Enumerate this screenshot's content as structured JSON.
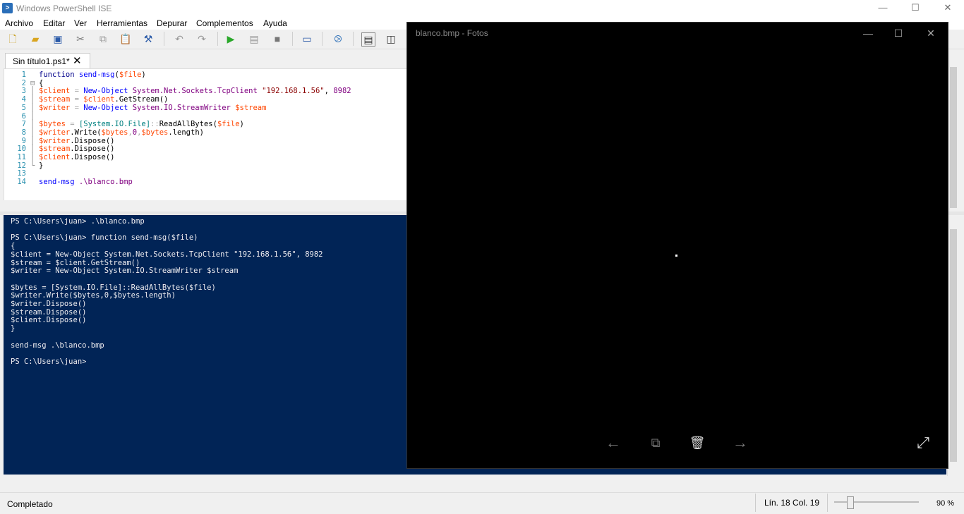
{
  "app": {
    "title": "Windows PowerShell ISE",
    "icon_glyph": ">",
    "minimize": "—",
    "maximize": "☐",
    "close": "✕"
  },
  "menu": [
    "Archivo",
    "Editar",
    "Ver",
    "Herramientas",
    "Depurar",
    "Complementos",
    "Ayuda"
  ],
  "toolbar": {
    "icons": [
      "new-file-icon",
      "open-folder-icon",
      "save-icon",
      "cut-icon",
      "copy-icon",
      "paste-icon",
      "clear-icon",
      "undo-icon",
      "redo-icon",
      "run-icon",
      "run-selection-icon",
      "stop-icon",
      "remote-icon",
      "powershell-icon",
      "layout-top-icon",
      "layout-side-icon"
    ]
  },
  "tab": {
    "label": "Sin título1.ps1*",
    "close": "✕"
  },
  "editor": {
    "lines": [
      "1",
      "2",
      "3",
      "4",
      "5",
      "6",
      "7",
      "8",
      "9",
      "10",
      "11",
      "12",
      "13",
      "14"
    ],
    "fold_marks": [
      "",
      "⊟",
      "│",
      "│",
      "│",
      "│",
      "│",
      "│",
      "│",
      "│",
      "│",
      "└",
      "",
      ""
    ]
  },
  "console": {
    "lines": [
      "PS C:\\Users\\juan> .\\blanco.bmp",
      "",
      "PS C:\\Users\\juan> function send-msg($file)",
      "{",
      "$client = New-Object System.Net.Sockets.TcpClient \"192.168.1.56\", 8982",
      "$stream = $client.GetStream()",
      "$writer = New-Object System.IO.StreamWriter $stream",
      "",
      "$bytes = [System.IO.File]::ReadAllBytes($file)",
      "$writer.Write($bytes,0,$bytes.length)",
      "$writer.Dispose()",
      "$stream.Dispose()",
      "$client.Dispose()",
      "}",
      "",
      "send-msg .\\blanco.bmp",
      "",
      "PS C:\\Users\\juan>"
    ]
  },
  "status": {
    "text": "Completado",
    "position": "Lín. 18  Col. 19",
    "zoom": "90 %",
    "zoom_fraction": 0.18
  },
  "photos": {
    "title": "blanco.bmp - Fotos",
    "minimize": "—",
    "maximize": "☐",
    "close": "✕",
    "prev": "←",
    "slideshow": "⧉",
    "delete": "🗑",
    "next": "→",
    "fullscreen": "⤢"
  }
}
